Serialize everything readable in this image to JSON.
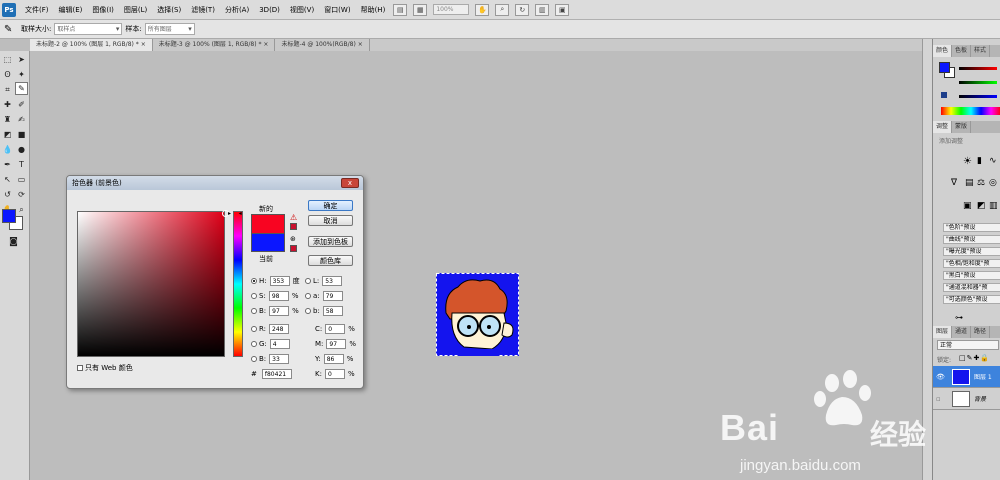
{
  "app": {
    "logo_text": "Ps"
  },
  "menubar": {
    "items": [
      "文件(F)",
      "编辑(E)",
      "图像(I)",
      "图层(L)",
      "选择(S)",
      "滤镜(T)",
      "分析(A)",
      "3D(D)",
      "视图(V)",
      "窗口(W)",
      "帮助(H)"
    ],
    "zoom_value": "100%"
  },
  "options_bar": {
    "sample_size_label": "取样大小:",
    "sample_size_value": "取样点",
    "sample_label": "样本:",
    "sample_value": "所有图层"
  },
  "doc_tabs": [
    {
      "label": "未标题-2 @ 100% (图层 1, RGB/8) *",
      "close": "×"
    },
    {
      "label": "未标题-3 @ 100% (图层 1, RGB/8) *",
      "close": "×"
    },
    {
      "label": "未标题-4 @ 100%(RGB/8)",
      "close": "×"
    }
  ],
  "panels": {
    "color_tabs": [
      "颜色",
      "色板",
      "样式"
    ],
    "adjust_tabs": [
      "调整",
      "蒙版"
    ],
    "adjust_hint": "添加调整",
    "presets": [
      "\"色阶\"预设",
      "\"曲线\"预设",
      "\"曝光度\"预设",
      "\"色相/饱和度\"预",
      "\"黑白\"预设",
      "\"通道混和器\"预",
      "\"可选颜色\"预设"
    ],
    "layers_tabs": [
      "图层",
      "通道",
      "路径"
    ],
    "blend_mode": "正常",
    "lock_label": "锁定:",
    "layers": [
      {
        "name": "图层 1"
      },
      {
        "name": "背景"
      }
    ]
  },
  "colors": {
    "foreground": "#0b16ff",
    "background": "#ffffff",
    "new_color": "#f80421",
    "current_color": "#0b16ff"
  },
  "color_picker": {
    "title": "拾色器 (前景色)",
    "close": "x",
    "new_label": "新的",
    "current_label": "当前",
    "buttons": {
      "ok": "确定",
      "cancel": "取消",
      "add_swatch": "添加到色板",
      "libraries": "颜色库"
    },
    "hsb": {
      "h_label": "H:",
      "h": "353",
      "h_unit": "度",
      "s_label": "S:",
      "s": "98",
      "s_unit": "%",
      "b_label": "B:",
      "b": "97",
      "b_unit": "%"
    },
    "rgb": {
      "r_label": "R:",
      "r": "248",
      "g_label": "G:",
      "g": "4",
      "b_label": "B:",
      "b": "33"
    },
    "lab": {
      "l_label": "L:",
      "l": "53",
      "a_label": "a:",
      "a": "79",
      "b_label": "b:",
      "b": "58"
    },
    "cmyk": {
      "c_label": "C:",
      "c": "0",
      "m_label": "M:",
      "m": "97",
      "y_label": "Y:",
      "y": "86",
      "k_label": "K:",
      "k": "0",
      "unit": "%"
    },
    "hex_label": "#",
    "hex": "f80421",
    "web_only_label": "只有 Web 颜色"
  },
  "watermark": {
    "brand": "Bai",
    "brand_cn": "经验",
    "url": "jingyan.baidu.com"
  }
}
